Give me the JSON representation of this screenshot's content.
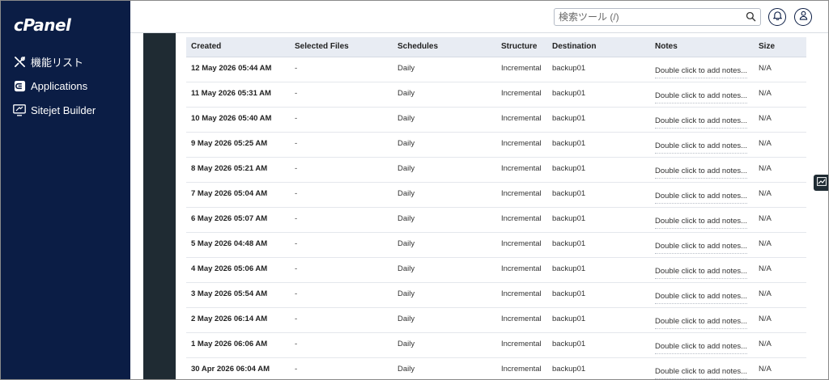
{
  "app": {
    "logo_text": "cPanel"
  },
  "sidebar": {
    "items": [
      {
        "label": "機能リスト",
        "icon": "tools-icon"
      },
      {
        "label": "Applications",
        "icon": "applications-icon"
      },
      {
        "label": "Sitejet Builder",
        "icon": "sitejet-icon"
      }
    ]
  },
  "header": {
    "search_placeholder": "検索ツール (/)"
  },
  "colors": {
    "sidebar": "#0b1d45",
    "header_row": "#e8ecf3",
    "dark_strip": "#1f2b33"
  },
  "table": {
    "columns": [
      "Created",
      "Selected Files",
      "Schedules",
      "Structure",
      "Destination",
      "Notes",
      "Size"
    ],
    "rows": [
      {
        "created": "12 May 2026 05:44 AM",
        "files": "-",
        "schedule": "Daily",
        "structure": "Incremental",
        "destination": "backup01",
        "notes": "Double click to add notes...",
        "size": "N/A"
      },
      {
        "created": "11 May 2026 05:31 AM",
        "files": "-",
        "schedule": "Daily",
        "structure": "Incremental",
        "destination": "backup01",
        "notes": "Double click to add notes...",
        "size": "N/A"
      },
      {
        "created": "10 May 2026 05:40 AM",
        "files": "-",
        "schedule": "Daily",
        "structure": "Incremental",
        "destination": "backup01",
        "notes": "Double click to add notes...",
        "size": "N/A"
      },
      {
        "created": "9 May 2026 05:25 AM",
        "files": "-",
        "schedule": "Daily",
        "structure": "Incremental",
        "destination": "backup01",
        "notes": "Double click to add notes...",
        "size": "N/A"
      },
      {
        "created": "8 May 2026 05:21 AM",
        "files": "-",
        "schedule": "Daily",
        "structure": "Incremental",
        "destination": "backup01",
        "notes": "Double click to add notes...",
        "size": "N/A"
      },
      {
        "created": "7 May 2026 05:04 AM",
        "files": "-",
        "schedule": "Daily",
        "structure": "Incremental",
        "destination": "backup01",
        "notes": "Double click to add notes...",
        "size": "N/A"
      },
      {
        "created": "6 May 2026 05:07 AM",
        "files": "-",
        "schedule": "Daily",
        "structure": "Incremental",
        "destination": "backup01",
        "notes": "Double click to add notes...",
        "size": "N/A"
      },
      {
        "created": "5 May 2026 04:48 AM",
        "files": "-",
        "schedule": "Daily",
        "structure": "Incremental",
        "destination": "backup01",
        "notes": "Double click to add notes...",
        "size": "N/A"
      },
      {
        "created": "4 May 2026 05:06 AM",
        "files": "-",
        "schedule": "Daily",
        "structure": "Incremental",
        "destination": "backup01",
        "notes": "Double click to add notes...",
        "size": "N/A"
      },
      {
        "created": "3 May 2026 05:54 AM",
        "files": "-",
        "schedule": "Daily",
        "structure": "Incremental",
        "destination": "backup01",
        "notes": "Double click to add notes...",
        "size": "N/A"
      },
      {
        "created": "2 May 2026 06:14 AM",
        "files": "-",
        "schedule": "Daily",
        "structure": "Incremental",
        "destination": "backup01",
        "notes": "Double click to add notes...",
        "size": "N/A"
      },
      {
        "created": "1 May 2026 06:06 AM",
        "files": "-",
        "schedule": "Daily",
        "structure": "Incremental",
        "destination": "backup01",
        "notes": "Double click to add notes...",
        "size": "N/A"
      },
      {
        "created": "30 Apr 2026 06:04 AM",
        "files": "-",
        "schedule": "Daily",
        "structure": "Incremental",
        "destination": "backup01",
        "notes": "Double click to add notes...",
        "size": "N/A"
      }
    ]
  }
}
